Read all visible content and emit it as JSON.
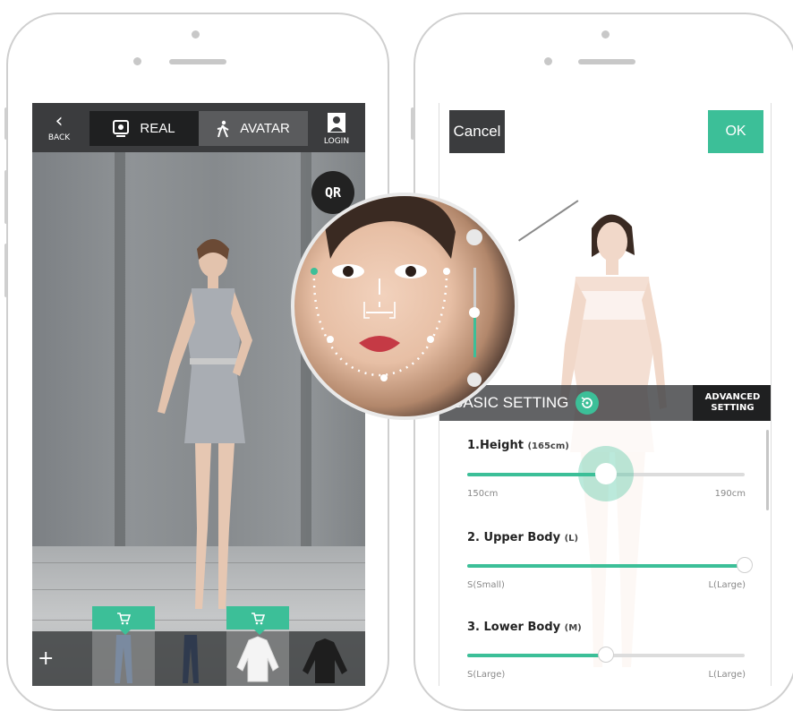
{
  "left_phone": {
    "topbar": {
      "back_label": "BACK",
      "real_label": "REAL",
      "avatar_label": "AVATAR",
      "login_label": "LOGIN"
    },
    "qr_label": "QR",
    "tray": {
      "add_label": "+",
      "items": [
        {
          "icon": "jeans-icon",
          "selected": true,
          "cart": true
        },
        {
          "icon": "dark-jeans-icon",
          "selected": false,
          "cart": false
        },
        {
          "icon": "white-sweater-icon",
          "selected": true,
          "cart": true
        },
        {
          "icon": "black-sweater-icon",
          "selected": false,
          "cart": false
        }
      ]
    }
  },
  "right_phone": {
    "cancel_label": "Cancel",
    "ok_label": "OK",
    "basic_setting_label": "BASIC SETTING",
    "advanced_setting_label": "ADVANCED SETTING",
    "sliders": [
      {
        "title": "1.Height",
        "value_label": "(165cm)",
        "min_label": "150cm",
        "max_label": "190cm",
        "level": 0.5
      },
      {
        "title": "2. Upper Body",
        "value_label": "(L)",
        "min_label": "S(Small)",
        "max_label": "L(Large)",
        "level": 1.0
      },
      {
        "title": "3. Lower Body",
        "value_label": "(M)",
        "min_label": "S(Large)",
        "max_label": "L(Large)",
        "level": 0.5
      }
    ]
  },
  "colors": {
    "accent": "#3cbf98",
    "dark_bar": "#3b3c3e"
  }
}
